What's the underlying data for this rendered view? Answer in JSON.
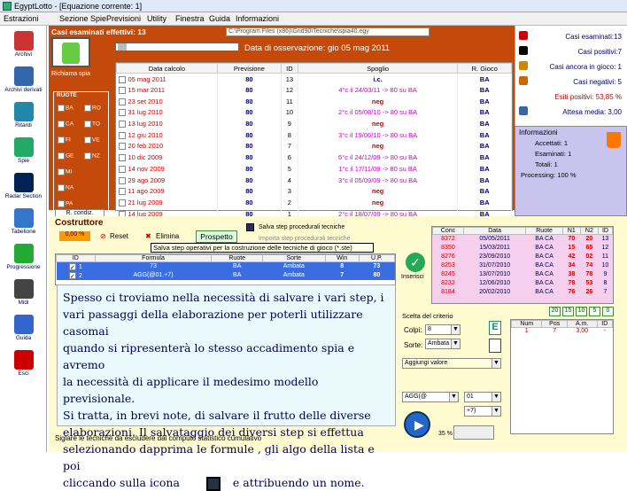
{
  "window": {
    "title": "EgyptLotto - [Equazione corrente: 1]"
  },
  "menu": [
    "Estrazioni",
    "Sezione Spie",
    "Previsioni",
    "Utility",
    "Finestra",
    "Guida",
    "Informazioni"
  ],
  "sidebar": [
    {
      "label": "Archivi",
      "color": "#c33"
    },
    {
      "label": "Archivi derivati",
      "color": "#36a"
    },
    {
      "label": "Ritardi",
      "color": "#28a"
    },
    {
      "label": "Spie",
      "color": "#2a6"
    },
    {
      "label": "Radar Section",
      "color": "#025"
    },
    {
      "label": "Tabellone",
      "color": "#37c"
    },
    {
      "label": "Progressione",
      "color": "#2a3"
    },
    {
      "label": "Midi",
      "color": "#444"
    },
    {
      "label": "Guida",
      "color": "#36c"
    },
    {
      "label": "Esci",
      "color": "#c00"
    }
  ],
  "casi": {
    "label": "Casi esaminati effettivi: 13",
    "path": "C:\\Program Files (x86)\\Grid90\\Tecniche\\spia40.egy",
    "date_label": "Data di osservazione:  gio 05 mag 2011",
    "richiama": "Richiama spia"
  },
  "ruote": {
    "title": "RUOTE",
    "items": [
      [
        "BA",
        "RO"
      ],
      [
        "CA",
        "TO"
      ],
      [
        "FI",
        "VE"
      ],
      [
        "GE",
        "NZ"
      ],
      [
        "MI",
        ""
      ],
      [
        "NA",
        ""
      ],
      [
        "PA",
        ""
      ]
    ],
    "rcond": "R. condiz."
  },
  "table": {
    "headers": [
      "Data calcolo",
      "Previsione",
      "ID",
      "Spoglio",
      "R. Gioco"
    ],
    "rows": [
      [
        "05 mag 2011",
        "80",
        "13",
        "i.c.",
        "BA"
      ],
      [
        "15 mar 2011",
        "80",
        "12",
        "4°c il 24/03/11 -> 80 su BA",
        "BA"
      ],
      [
        "23 set 2010",
        "80",
        "11",
        "neg",
        "BA"
      ],
      [
        "31 lug 2010",
        "80",
        "10",
        "2°c il 05/08/10 -> 80 su BA",
        "BA"
      ],
      [
        "13 lug 2010",
        "80",
        "9",
        "neg",
        "BA"
      ],
      [
        "12 giu 2010",
        "80",
        "8",
        "3°c il 19/06/10 -> 80 su BA",
        "BA"
      ],
      [
        "20 feb 2010",
        "80",
        "7",
        "neg",
        "BA"
      ],
      [
        "10 dic 2009",
        "80",
        "6",
        "6°c il 24/12/09 -> 80 su BA",
        "BA"
      ],
      [
        "14 nov 2009",
        "80",
        "5",
        "1°c il 17/11/09 -> 80 su BA",
        "BA"
      ],
      [
        "29 ago 2009",
        "80",
        "4",
        "3°c il 05/09/09 -> 80 su BA",
        "BA"
      ],
      [
        "11 ago 2009",
        "80",
        "3",
        "neg",
        "BA"
      ],
      [
        "21 lug 2009",
        "80",
        "2",
        "neg",
        "BA"
      ],
      [
        "14 lug 2009",
        "80",
        "1",
        "2°c il 18/07/09 -> 80 su BA",
        "BA"
      ]
    ]
  },
  "stats": [
    "Casi esaminati:13",
    "Casi positivi:7",
    "Casi ancora in gioco: 1",
    "Casi negativi: 5",
    "Esiti positivi: 53,85 %",
    "Attesa media: 3,00"
  ],
  "info": {
    "title": "Informazioni",
    "lines": [
      "Accettati:   1",
      "Esaminati:   1",
      "Totali:   1",
      "Processing:   100 %"
    ]
  },
  "costr": {
    "title": "Costruttore",
    "pct": "0,00 %",
    "reset": "Reset",
    "elimina": "Elimina",
    "prospetto": "Prospetto",
    "salva": "Salva step procedurali tecniche",
    "importa": "Importa step procedurali tecniche",
    "tooltip": "Salva step operativi per la costruzione delle tecniche di gioco (*.ste)",
    "inserisci": "Inserisci",
    "footer": "Siglare le tecniche da escludere dal computo statistico cumulativo"
  },
  "steps": {
    "headers": [
      "ID",
      "Formula",
      "Ruote",
      "Sorte",
      "Win",
      "U.P."
    ],
    "rows": [
      [
        "1",
        "73",
        "BA",
        "Ambata",
        "8",
        "73"
      ],
      [
        "2",
        "AGG(@01.+7)",
        "BA",
        "Ambata",
        "7",
        "80"
      ]
    ]
  },
  "help": [
    "Spesso ci troviamo nella necessità di salvare i vari step, i",
    "vari passaggi della elaborazione per poterli utilizzare casomai",
    "quando si ripresenterà lo stesso accadimento spia e avremo",
    "la necessità di applicare il medesimo modello previsionale.",
    "Si tratta, in brevi note, di salvare il frutto delle diverse",
    "elaborazioni. Il salvataggio dei diversi step si effettua",
    "selezionando dapprima le formule , gli algo della lista e poi",
    "cliccando sulla icona",
    "e attribuendo un nome."
  ],
  "conc": {
    "headers": [
      "Conc",
      "Data",
      "Ruote",
      "N1",
      "N2",
      "ID"
    ],
    "rows": [
      [
        "8372",
        "05/05/2011",
        "BA CA",
        "70",
        "20",
        "13"
      ],
      [
        "8350",
        "15/03/2011",
        "BA CA",
        "15",
        "65",
        "12"
      ],
      [
        "8276",
        "23/09/2010",
        "BA CA",
        "42",
        "02",
        "11"
      ],
      [
        "8253",
        "31/07/2010",
        "BA CA",
        "34",
        "74",
        "10"
      ],
      [
        "8245",
        "13/07/2010",
        "BA CA",
        "38",
        "78",
        "9"
      ],
      [
        "8232",
        "12/06/2010",
        "BA CA",
        "78",
        "53",
        "8"
      ],
      [
        "8184",
        "20/02/2010",
        "BA CA",
        "76",
        "26",
        "7"
      ]
    ],
    "counts": [
      "20",
      "15",
      "10",
      "5",
      "0"
    ]
  },
  "crit": {
    "title": "Scelta del criterio",
    "colpi_label": "Colpi:",
    "colpi": "8",
    "sorte_label": "Sorte:",
    "sorte": "Ambata",
    "aggiungi": "Aggiungi valore",
    "agg": "AGG(@",
    "v01": "01",
    "plus7": "+7)",
    "pct": "35 %"
  },
  "grid2": {
    "headers": [
      "Num",
      "Pos",
      "A.m.",
      "ID"
    ],
    "row": [
      "1",
      "7",
      "3,00",
      "-"
    ]
  }
}
